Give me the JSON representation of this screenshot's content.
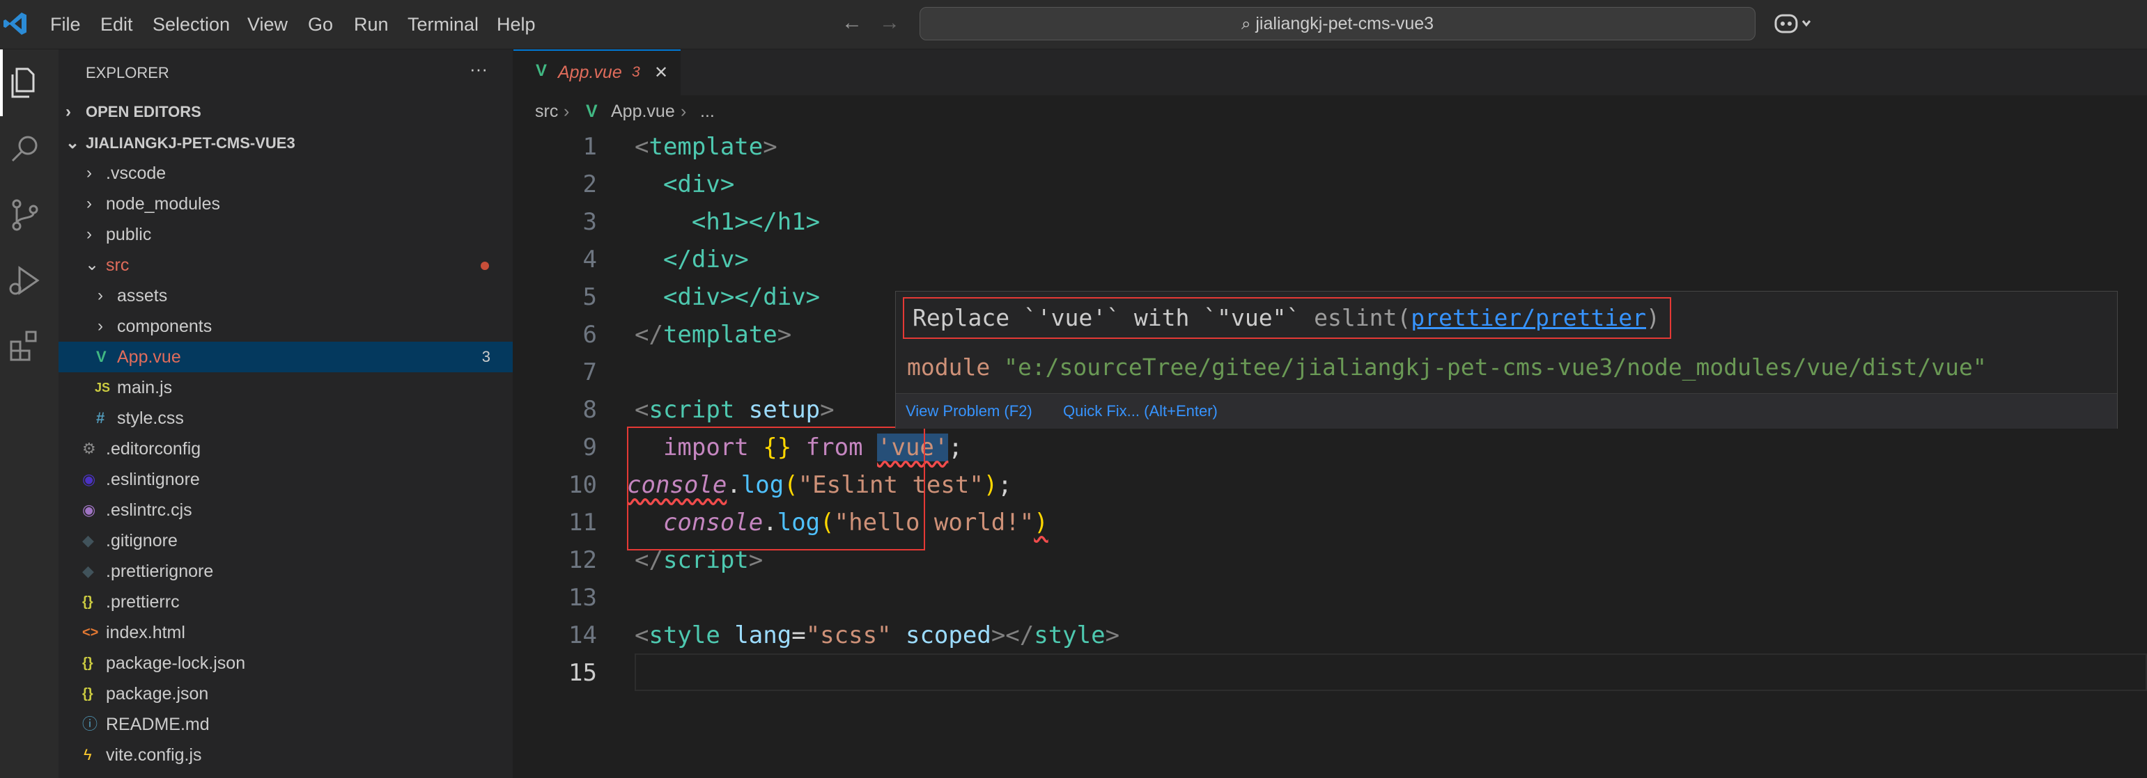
{
  "titlebar": {
    "menu": [
      {
        "label": "File"
      },
      {
        "label": "Edit"
      },
      {
        "label": "Selection"
      },
      {
        "label": "View"
      },
      {
        "label": "Go"
      },
      {
        "label": "Run"
      },
      {
        "label": "Terminal"
      },
      {
        "label": "Help"
      }
    ],
    "search_text": "jialiangkj-pet-cms-vue3"
  },
  "sidebar": {
    "title": "EXPLORER",
    "more": "···",
    "open_editors": "OPEN EDITORS",
    "project": "JIALIANGKJ-PET-CMS-VUE3",
    "items": [
      {
        "label": ".vscode"
      },
      {
        "label": "node_modules"
      },
      {
        "label": "public"
      },
      {
        "label": "src"
      },
      {
        "label": "assets"
      },
      {
        "label": "components"
      },
      {
        "label": "App.vue",
        "badge": "3"
      },
      {
        "label": "main.js",
        "icon": "JS"
      },
      {
        "label": "style.css",
        "icon": "#"
      },
      {
        "label": ".editorconfig"
      },
      {
        "label": ".eslintignore"
      },
      {
        "label": ".eslintrc.cjs"
      },
      {
        "label": ".gitignore"
      },
      {
        "label": ".prettierignore"
      },
      {
        "label": ".prettierrc",
        "icon": "{}"
      },
      {
        "label": "index.html",
        "icon": "<>"
      },
      {
        "label": "package-lock.json",
        "icon": "{}"
      },
      {
        "label": "package.json",
        "icon": "{}"
      },
      {
        "label": "README.md"
      },
      {
        "label": "vite.config.js"
      }
    ]
  },
  "tab": {
    "label": "App.vue",
    "count": "3",
    "close": "✕"
  },
  "breadcrumb": {
    "part1": "src",
    "part2": "App.vue",
    "part3": "..."
  },
  "editor": {
    "line_numbers": [
      "1",
      "2",
      "3",
      "4",
      "5",
      "6",
      "7",
      "8",
      "9",
      "10",
      "11",
      "12",
      "13",
      "14",
      "15"
    ],
    "code": {
      "l1_open": "<",
      "l1_tag": "template",
      "l1_close": ">",
      "l2": "  <div>",
      "l3": "    <h1></h1>",
      "l4": "  </div>",
      "l5": "  <div></div>",
      "l6_open": "</",
      "l6_tag": "template",
      "l6_close": ">",
      "l8_open": "<",
      "l8_tag": "script",
      "l8_attr": " setup",
      "l8_close": ">",
      "l9_import": "  import ",
      "l9_braces": "{}",
      "l9_from": " from ",
      "l9_str": "'vue'",
      "l9_semi": ";",
      "l10_console": "console",
      "l10_dot": ".",
      "l10_log": "log",
      "l10_po": "(",
      "l10_str": "\"Eslint test\"",
      "l10_pc": ")",
      "l10_semi": ";",
      "l11_indent": "  ",
      "l11_console": "console",
      "l11_dot": ".",
      "l11_log": "log",
      "l11_po": "(",
      "l11_str": "\"hello world!\"",
      "l11_pc": ")",
      "l12_open": "</",
      "l12_tag": "script",
      "l12_close": ">",
      "l14_open": "<",
      "l14_tag": "style",
      "l14_attr": " lang",
      "l14_eq": "=",
      "l14_val": "\"scss\"",
      "l14_attr2": " scoped",
      "l14_mid": "></",
      "l14_tag2": "style",
      "l14_close": ">"
    }
  },
  "hover": {
    "message": "Replace `'vue'` with `\"vue\"` ",
    "source": "eslint(",
    "rule": "prettier/prettier",
    "source_end": ")",
    "module_kw": "module ",
    "module_path": "\"e:/sourceTree/gitee/jialiangkj-pet-cms-vue3/node_modules/vue/dist/vue\"",
    "view_problem": "View Problem (F2)",
    "quick_fix": "Quick Fix... (Alt+Enter)"
  },
  "colors": {
    "accent": "#0078d4",
    "error": "#e53935",
    "tag": "#4ec9b0",
    "string": "#ce9178",
    "keyword": "#c586c0"
  }
}
